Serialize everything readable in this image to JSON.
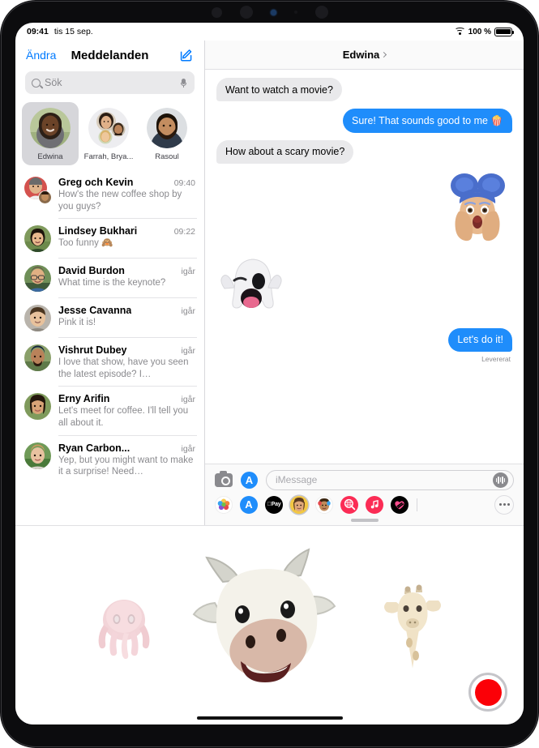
{
  "statusbar": {
    "time": "09:41",
    "date": "tis 15 sep.",
    "battery": "100 %",
    "wifi_icon": "wifi-icon",
    "battery_icon": "battery-icon"
  },
  "sidebar": {
    "edit_label": "Ändra",
    "title": "Meddelanden",
    "compose_icon": "compose-icon",
    "search": {
      "placeholder": "Sök",
      "icon": "search-icon",
      "mic_icon": "microphone-icon"
    },
    "pinned": [
      {
        "name": "Edwina",
        "selected": true
      },
      {
        "name": "Farrah, Brya...",
        "selected": false
      },
      {
        "name": "Rasoul",
        "selected": false
      }
    ],
    "conversations": [
      {
        "name": "Greg och Kevin",
        "time": "09:40",
        "preview": "How's the new coffee shop by you guys?"
      },
      {
        "name": "Lindsey Bukhari",
        "time": "09:22",
        "preview": "Too funny 🙈"
      },
      {
        "name": "David Burdon",
        "time": "igår",
        "preview": "What time is the keynote?"
      },
      {
        "name": "Jesse Cavanna",
        "time": "igår",
        "preview": "Pink it is!"
      },
      {
        "name": "Vishrut Dubey",
        "time": "igår",
        "preview": "I love that show, have you seen the latest episode? I…"
      },
      {
        "name": "Erny Arifin",
        "time": "igår",
        "preview": "Let's meet for coffee. I'll tell you all about it."
      },
      {
        "name": "Ryan Carbon...",
        "time": "igår",
        "preview": "Yep, but you might want to make it a surprise! Need…"
      }
    ]
  },
  "detail": {
    "title": "Edwina",
    "chevron_icon": "chevron-right-icon",
    "messages": [
      {
        "type": "text",
        "dir": "in",
        "text": "Want to watch a movie?"
      },
      {
        "type": "text",
        "dir": "out",
        "text": "Sure! That sounds good to me 🍿"
      },
      {
        "type": "text",
        "dir": "in",
        "text": "How about a scary movie?"
      },
      {
        "type": "sticker",
        "dir": "out",
        "name": "memoji-shocked-blue-hair"
      },
      {
        "type": "sticker",
        "dir": "in",
        "name": "animoji-ghost-winking"
      },
      {
        "type": "text",
        "dir": "out",
        "text": "Let's do it!"
      }
    ],
    "delivery_status": "Levererat",
    "input": {
      "placeholder": "iMessage",
      "camera_icon": "camera-icon",
      "appstore_icon": "app-store-icon",
      "audio_icon": "audio-message-icon"
    },
    "apps": [
      {
        "name": "photos-app-icon",
        "label": "Photos",
        "selected": false
      },
      {
        "name": "app-store-app-icon",
        "label": "App Store",
        "selected": false
      },
      {
        "name": "apple-pay-app-icon",
        "label": "Pay",
        "selected": false
      },
      {
        "name": "memoji-app-icon",
        "label": "Memoji",
        "selected": true
      },
      {
        "name": "animoji-app-icon",
        "label": "Animoji",
        "selected": false
      },
      {
        "name": "images-app-icon",
        "label": "#images",
        "selected": false
      },
      {
        "name": "music-app-icon",
        "label": "Music",
        "selected": false
      },
      {
        "name": "digital-touch-app-icon",
        "label": "Digital Touch",
        "selected": false
      }
    ],
    "more_icon": "more-options-icon",
    "grabber_icon": "drag-handle-icon"
  },
  "animoji_panel": {
    "characters": [
      {
        "name": "octopus-animoji",
        "selected": false
      },
      {
        "name": "cow-animoji",
        "selected": true
      },
      {
        "name": "giraffe-animoji",
        "selected": false
      }
    ],
    "record_icon": "record-button",
    "record_color": "#fb0007"
  },
  "colors": {
    "accent": "#007aff",
    "bubble_out": "#1f8dfb",
    "bubble_in": "#e9e9eb"
  }
}
